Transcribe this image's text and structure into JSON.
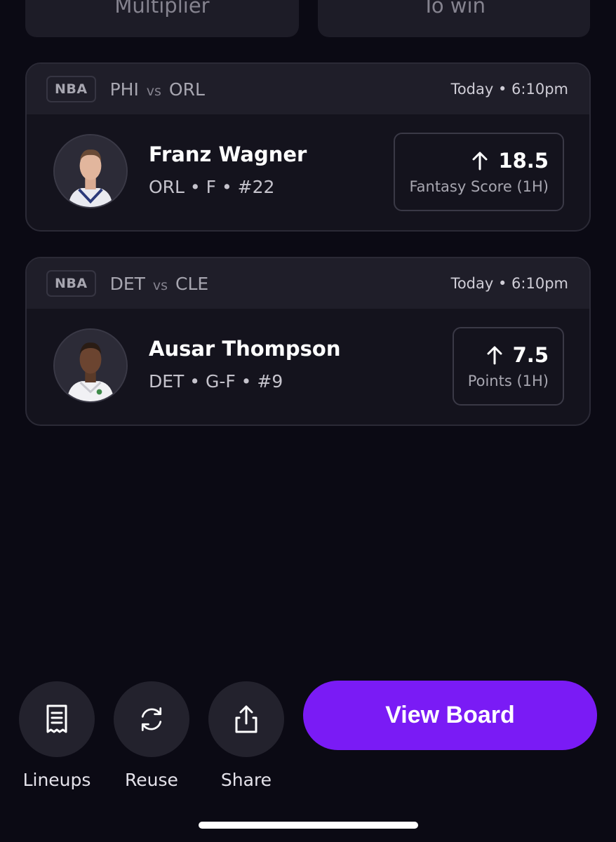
{
  "summary": {
    "left_label": "Multiplier",
    "right_label": "To win"
  },
  "picks": [
    {
      "league": "NBA",
      "team_a": "PHI",
      "vs": "vs",
      "team_b": "ORL",
      "time": "Today • 6:10pm",
      "player_name": "Franz Wagner",
      "player_meta": "ORL • F • #22",
      "line": "18.5",
      "stat": "Fantasy Score (1H)",
      "direction_icon": "arrow-up-icon"
    },
    {
      "league": "NBA",
      "team_a": "DET",
      "vs": "vs",
      "team_b": "CLE",
      "time": "Today • 6:10pm",
      "player_name": "Ausar Thompson",
      "player_meta": "DET • G-F • #9",
      "line": "7.5",
      "stat": "Points (1H)",
      "direction_icon": "arrow-up-icon"
    }
  ],
  "actions": [
    {
      "label": "Lineups",
      "icon": "receipt-icon"
    },
    {
      "label": "Reuse",
      "icon": "refresh-icon"
    },
    {
      "label": "Share",
      "icon": "share-icon"
    }
  ],
  "view_board_label": "View Board",
  "colors": {
    "background": "#0b0a14",
    "card": "#14131d",
    "card_header": "#1f1e29",
    "accent": "#7a1bf5"
  }
}
